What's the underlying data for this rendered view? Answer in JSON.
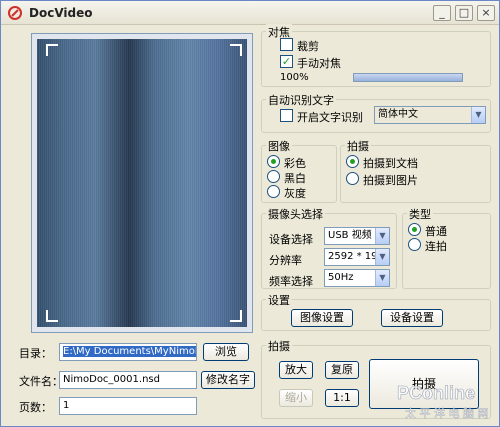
{
  "window": {
    "title": "DocVideo"
  },
  "title_buttons": {
    "minimize": "_",
    "maximize": "□",
    "close": "×"
  },
  "left": {
    "dir_label": "目录：",
    "dir_value": "E:\\My Documents\\MyNimoDoc",
    "browse": "浏览",
    "filename_label": "文件名：",
    "filename_value": "NimoDoc_0001.nsd",
    "rename": "修改名字",
    "pages_label": "页数：",
    "pages_value": "1"
  },
  "focus": {
    "legend": "对焦",
    "crop": {
      "label": "裁剪",
      "checked": false
    },
    "manual": {
      "label": "手动对焦",
      "checked": true
    },
    "percent_text": "100%",
    "progress": 1.0
  },
  "ocr": {
    "legend": "自动识别文字",
    "enable_label": "开启文字识别",
    "enabled": false,
    "language": "简体中文"
  },
  "image": {
    "legend": "图像",
    "options": [
      {
        "label": "彩色",
        "selected": true
      },
      {
        "label": "黑白",
        "selected": false
      },
      {
        "label": "灰度",
        "selected": false
      }
    ]
  },
  "shoot_to": {
    "legend": "拍摄",
    "options": [
      {
        "label": "拍摄到文档",
        "selected": true
      },
      {
        "label": "拍摄到图片",
        "selected": false
      }
    ]
  },
  "camera": {
    "legend": "摄像头选择",
    "device_label": "设备选择",
    "device_value": "USB 视频",
    "resolution_label": "分辨率",
    "resolution_value": "2592 * 19",
    "freq_label": "频率选择",
    "freq_value": "50Hz"
  },
  "type": {
    "legend": "类型",
    "options": [
      {
        "label": "普通",
        "selected": true
      },
      {
        "label": "连拍",
        "selected": false
      }
    ]
  },
  "settings": {
    "legend": "设置",
    "image_settings": "图像设置",
    "device_settings": "设备设置"
  },
  "capture": {
    "legend": "拍摄",
    "zoom_in": "放大",
    "restore": "复原",
    "zoom_out": "缩小",
    "ratio": "1:1",
    "shoot": "拍摄"
  },
  "colors": {
    "accent_check": "#21a121",
    "window_bg": "#ece9d8",
    "border": "#7f9db9"
  }
}
